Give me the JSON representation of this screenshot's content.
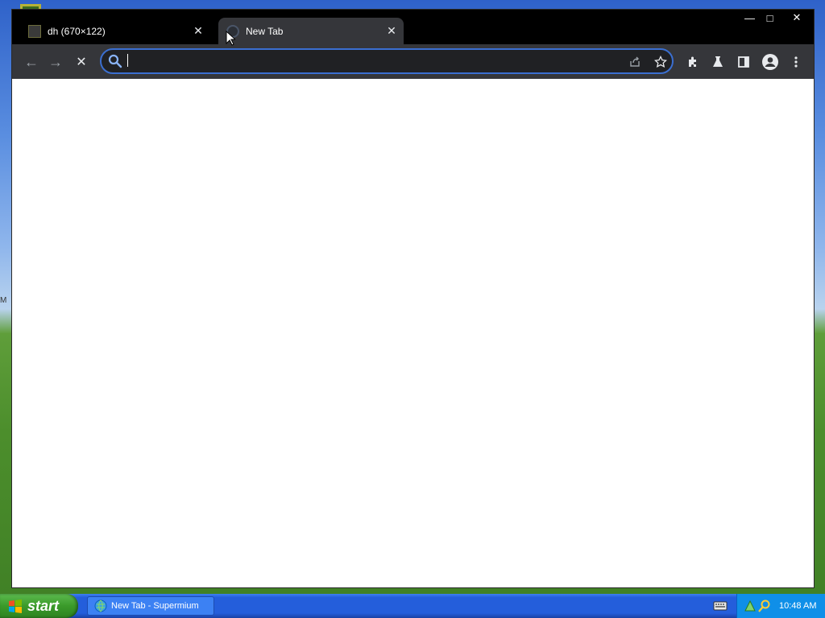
{
  "window": {
    "tabs": [
      {
        "title": "dh (670×122)",
        "favicon": "image-favicon",
        "close": "✕"
      },
      {
        "title": "New Tab",
        "favicon": "globe-favicon",
        "close": "✕",
        "active": true
      }
    ],
    "controls": {
      "minimize": "—",
      "maximize": "□",
      "close": "✕"
    }
  },
  "toolbar": {
    "back": "←",
    "forward": "→",
    "stop": "✕",
    "omnibox": {
      "value": "",
      "placeholder": ""
    },
    "icons": [
      "share-icon",
      "bookmark-star-icon",
      "extensions-icon",
      "labs-flask-icon",
      "side-panel-icon",
      "profile-icon",
      "menu-icon"
    ]
  },
  "taskbar": {
    "start_label": "start",
    "task_item": "New Tab - Supermium",
    "clock": "10:48 AM"
  },
  "colors": {
    "accent": "#3b6fd1",
    "toolbar": "#35363a",
    "titlebar": "#000000",
    "taskbar": "#245edb",
    "start": "#3a9a2a"
  }
}
